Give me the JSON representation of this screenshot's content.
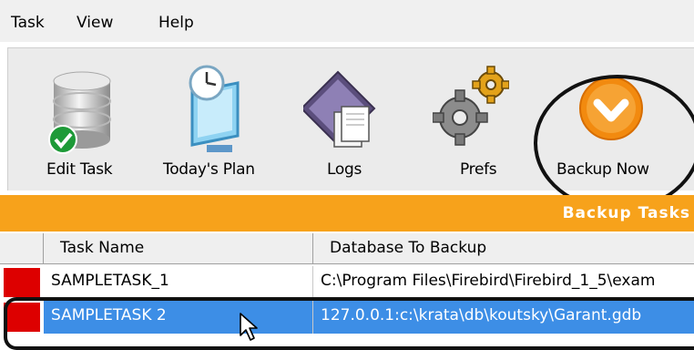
{
  "menu": {
    "items": [
      "Task",
      "View",
      "Help"
    ]
  },
  "toolbar": {
    "buttons": [
      {
        "label": "Edit Task",
        "icon": "database-check-icon"
      },
      {
        "label": "Today's Plan",
        "icon": "monitor-clock-icon"
      },
      {
        "label": "Logs",
        "icon": "logs-pages-icon"
      },
      {
        "label": "Prefs",
        "icon": "gears-icon"
      },
      {
        "label": "Backup Now",
        "icon": "backup-down-arrow-icon"
      }
    ]
  },
  "tasks": {
    "title": "Backup Tasks",
    "columns": [
      "Task Name",
      "Database To Backup"
    ],
    "rows": [
      {
        "name": "SAMPLETASK_1",
        "database": "C:\\Program Files\\Firebird\\Firebird_1_5\\exam",
        "selected": false
      },
      {
        "name": "SAMPLETASK 2",
        "database": "127.0.0.1:c:\\krata\\db\\koutsky\\Garant.gdb",
        "selected": true
      }
    ]
  },
  "colors": {
    "accent": "#f7a21b",
    "selection": "#3d8ee6",
    "status_indicator": "#dd0000"
  }
}
